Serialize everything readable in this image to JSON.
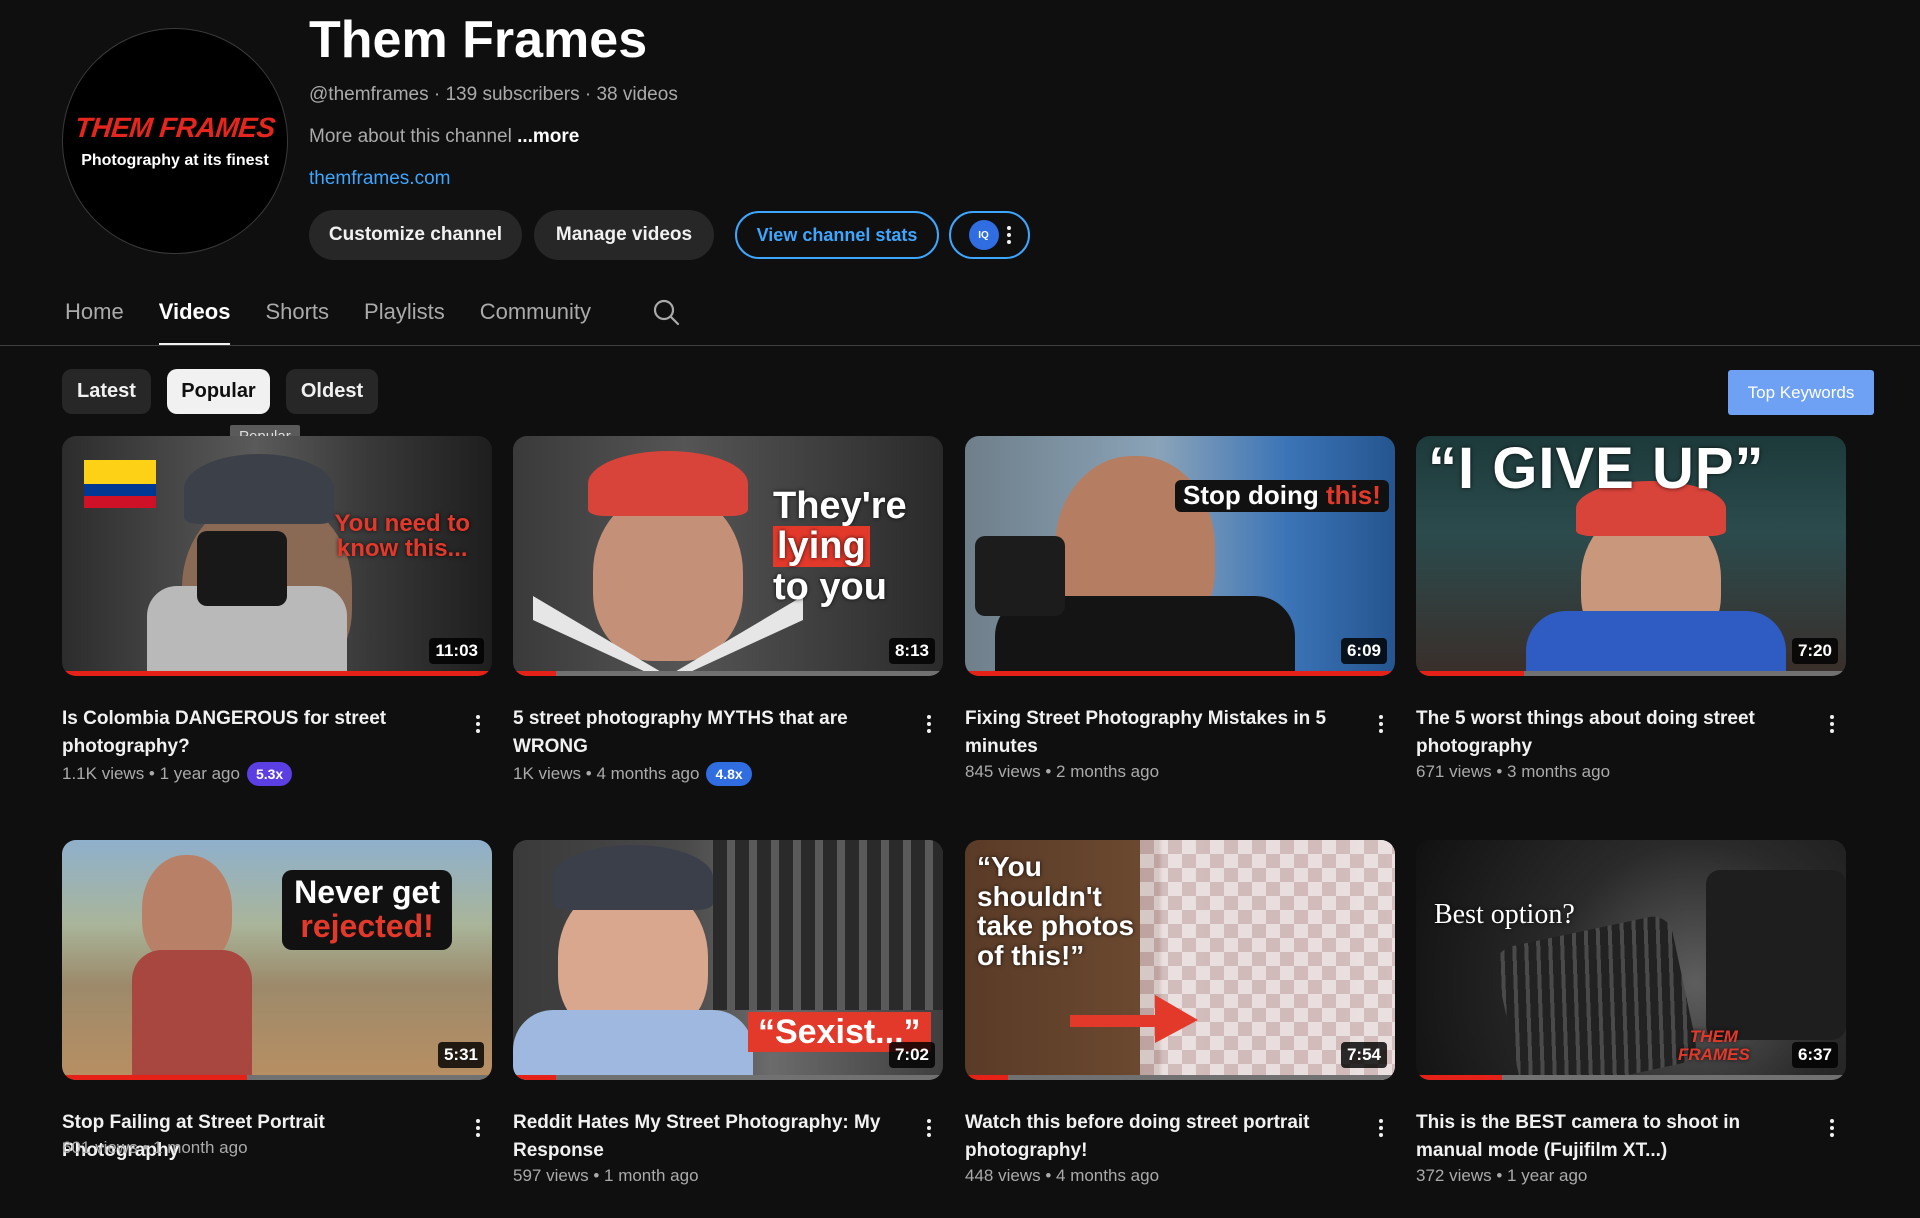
{
  "channel": {
    "avatar_brand": "THEM FRAMES",
    "avatar_tagline": "Photography at its finest",
    "title": "Them Frames",
    "meta": "@themframes · 139 subscribers · 38 videos",
    "description": "More about this channel",
    "more_label": "...more",
    "link": "themframes.com",
    "buttons": {
      "customize": "Customize channel",
      "manage": "Manage videos",
      "stats": "View channel stats",
      "iq_badge": "IQ"
    }
  },
  "tabs": [
    {
      "label": "Home",
      "active": false
    },
    {
      "label": "Videos",
      "active": true
    },
    {
      "label": "Shorts",
      "active": false
    },
    {
      "label": "Playlists",
      "active": false
    },
    {
      "label": "Community",
      "active": false
    }
  ],
  "chips": [
    {
      "label": "Latest",
      "selected": false
    },
    {
      "label": "Popular",
      "selected": true
    },
    {
      "label": "Oldest",
      "selected": false
    }
  ],
  "tooltip": "Popular",
  "top_keywords": "Top Keywords",
  "colors": {
    "accent_blue": "#3ea6ff",
    "progress_red": "#e62117",
    "badge_purple": "#5b3fe3",
    "badge_blue": "#2f6de1"
  },
  "videos": [
    {
      "title": "Is Colombia DANGEROUS for street photography?",
      "views": "1.1K views",
      "age": "1 year ago",
      "multiplier": "5.3x",
      "duration": "11:03",
      "watched_fraction": 1.0,
      "thumb_text": [
        "You need to",
        "know this..."
      ]
    },
    {
      "title": "5 street photography MYTHS that are WRONG",
      "views": "1K views",
      "age": "4 months ago",
      "multiplier": "4.8x",
      "duration": "8:13",
      "watched_fraction": 0.1,
      "thumb_text": [
        "They're",
        "lying",
        "to you"
      ]
    },
    {
      "title": "Fixing Street Photography Mistakes in 5 minutes",
      "views": "845 views",
      "age": "2 months ago",
      "duration": "6:09",
      "watched_fraction": 1.0,
      "thumb_text": [
        "Stop doing ",
        "this!"
      ]
    },
    {
      "title": "The 5 worst things about doing street photography",
      "views": "671 views",
      "age": "3 months ago",
      "duration": "7:20",
      "watched_fraction": 0.25,
      "thumb_text": [
        "“I GIVE UP”"
      ]
    },
    {
      "title": "Stop Failing at Street Portrait Photography",
      "views": "601 views",
      "age": "1 month ago",
      "duration": "5:31",
      "watched_fraction": 0.43,
      "thumb_text": [
        "Never get",
        "rejected!"
      ]
    },
    {
      "title": "Reddit Hates My Street Photography: My Response",
      "views": "597 views",
      "age": "1 month ago",
      "duration": "7:02",
      "watched_fraction": 0.1,
      "thumb_text": [
        "“Sexist...”"
      ]
    },
    {
      "title": "Watch this before doing street portrait photography!",
      "views": "448 views",
      "age": "4 months ago",
      "duration": "7:54",
      "watched_fraction": 0.1,
      "thumb_text": [
        "“You",
        "shouldn't",
        "take photos",
        "of this!”"
      ]
    },
    {
      "title": "This is the BEST camera to shoot in manual mode (Fujifilm XT...)",
      "views": "372 views",
      "age": "1 year ago",
      "duration": "6:37",
      "watched_fraction": 0.2,
      "thumb_text": [
        "Best option?",
        "THEM",
        "FRAMES"
      ]
    }
  ]
}
